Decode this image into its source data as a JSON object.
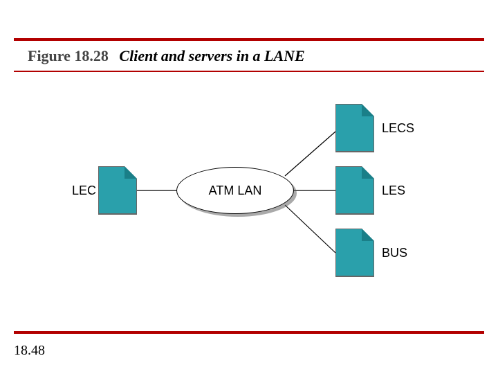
{
  "figure": {
    "number": "Figure 18.28",
    "caption": "Client and servers in a LANE"
  },
  "diagram": {
    "center_label": "ATM LAN",
    "left_node": {
      "label": "LEC"
    },
    "right_nodes": [
      {
        "label": "LECS"
      },
      {
        "label": "LES"
      },
      {
        "label": "BUS"
      }
    ]
  },
  "page_number": "18.48"
}
